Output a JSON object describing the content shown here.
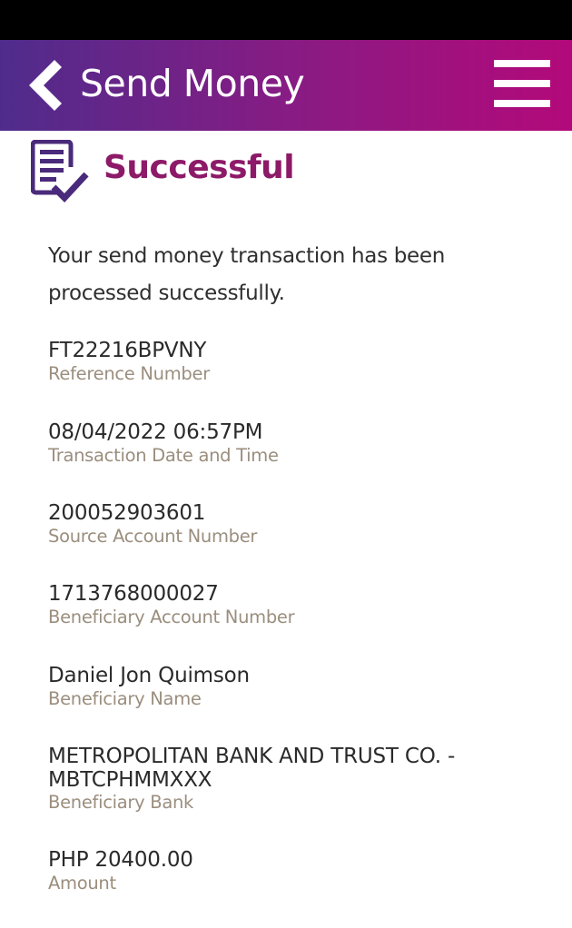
{
  "header": {
    "title": "Send Money",
    "back_icon": "chevron-left-icon",
    "menu_icon": "hamburger-menu-icon",
    "gradient_colors": [
      "#4f2c8c",
      "#8c1a83",
      "#b3097a"
    ]
  },
  "status": {
    "title": "Successful",
    "icon": "document-check-icon",
    "title_color": "#8d1a68",
    "icon_color": "#4a2a7a",
    "message": "Your send money transaction has been processed successfully."
  },
  "details": [
    {
      "value": "FT22216BPVNY",
      "label": "Reference Number"
    },
    {
      "value": "08/04/2022 06:57PM",
      "label": "Transaction Date and Time"
    },
    {
      "value": "200052903601",
      "label": "Source Account Number"
    },
    {
      "value": "1713768000027",
      "label": "Beneficiary Account Number"
    },
    {
      "value": "Daniel Jon Quimson",
      "label": "Beneficiary Name"
    },
    {
      "value": "METROPOLITAN BANK AND TRUST CO. - MBTCPHMMXXX",
      "label": "Beneficiary Bank"
    },
    {
      "value": "PHP 20400.00",
      "label": "Amount"
    }
  ],
  "colors": {
    "label": "#9b8e7e",
    "value": "#2a2a2a"
  }
}
